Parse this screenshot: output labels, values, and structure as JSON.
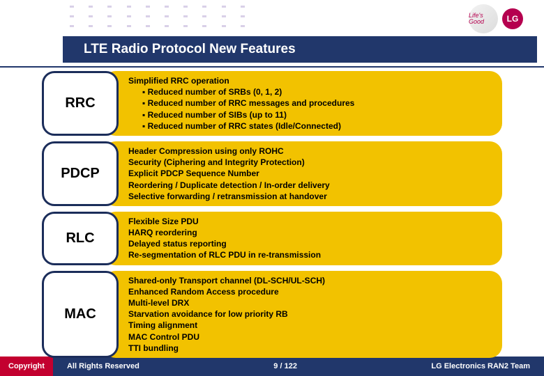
{
  "logo": {
    "tagline": "Life's Good",
    "brand": "LG"
  },
  "title": "LTE Radio Protocol New Features",
  "rows": [
    {
      "label": "RRC",
      "heading": "Simplified RRC operation",
      "items": [
        "Reduced number of SRBs (0, 1, 2)",
        "Reduced number of RRC messages and procedures",
        "Reduced number of SIBs (up to 11)",
        "Reduced number of RRC states (Idle/Connected)"
      ]
    },
    {
      "label": "PDCP",
      "lines": [
        "Header Compression using only ROHC",
        "Security (Ciphering and Integrity Protection)",
        "Explicit PDCP Sequence Number",
        "Reordering / Duplicate detection / In-order delivery",
        "Selective forwarding / retransmission at handover"
      ]
    },
    {
      "label": "RLC",
      "lines": [
        "Flexible Size PDU",
        "HARQ reordering",
        "Delayed status reporting",
        "Re-segmentation of RLC PDU in re-transmission"
      ]
    },
    {
      "label": "MAC",
      "lines": [
        "Shared-only Transport channel (DL-SCH/UL-SCH)",
        "Enhanced Random Access procedure",
        "Multi-level DRX",
        "Starvation avoidance for low priority RB",
        "Timing alignment",
        "MAC Control PDU",
        "TTI bundling"
      ]
    }
  ],
  "footer": {
    "copyright": "Copyright",
    "reserved": "All Rights Reserved",
    "page": "9 / 122",
    "team": "LG Electronics RAN2 Team"
  }
}
